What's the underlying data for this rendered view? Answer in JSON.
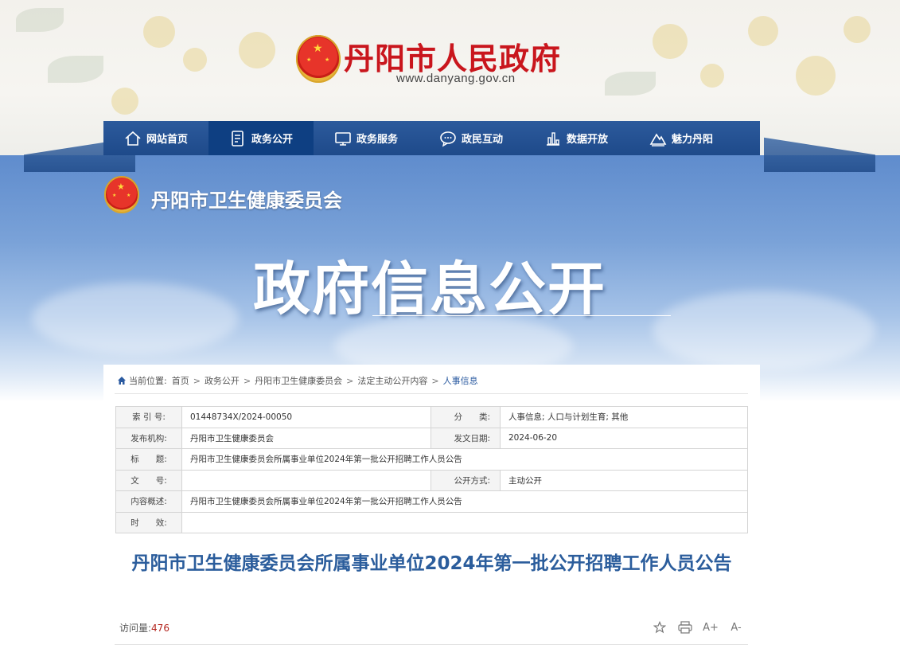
{
  "header": {
    "site_title": "丹阳市人民政府",
    "site_url": "www.danyang.gov.cn"
  },
  "nav": {
    "items": [
      {
        "label": "网站首页",
        "icon": "home-icon"
      },
      {
        "label": "政务公开",
        "icon": "document-icon",
        "active": true
      },
      {
        "label": "政务服务",
        "icon": "monitor-icon"
      },
      {
        "label": "政民互动",
        "icon": "chat-icon"
      },
      {
        "label": "数据开放",
        "icon": "bar-chart-icon"
      },
      {
        "label": "魅力丹阳",
        "icon": "landscape-icon"
      }
    ]
  },
  "hero": {
    "department": "丹阳市卫生健康委员会",
    "title": "政府信息公开"
  },
  "breadcrumb": {
    "label": "当前位置:",
    "items": [
      "首页",
      "政务公开",
      "丹阳市卫生健康委员会",
      "法定主动公开内容",
      "人事信息"
    ]
  },
  "meta": {
    "index_label": "索 引 号:",
    "index_value": "01448734X/2024-00050",
    "category_label": "分　　类:",
    "category_value": "人事信息;  人口与计划生育;  其他",
    "publisher_label": "发布机构:",
    "publisher_value": "丹阳市卫生健康委员会",
    "date_label": "发文日期:",
    "date_value": "2024-06-20",
    "title_label": "标　　题:",
    "title_value": "丹阳市卫生健康委员会所属事业单位2024年第一批公开招聘工作人员公告",
    "docno_label": "文　　号:",
    "docno_value": "",
    "disclosure_label": "公开方式:",
    "disclosure_value": "主动公开",
    "summary_label": "内容概述:",
    "summary_value": "丹阳市卫生健康委员会所属事业单位2024年第一批公开招聘工作人员公告",
    "validity_label": "时　　效:",
    "validity_value": ""
  },
  "article": {
    "title": "丹阳市卫生健康委员会所属事业单位2024年第一批公开招聘工作人员公告",
    "visits_label": "访问量:",
    "visits_value": "476"
  },
  "tools": {
    "font_increase": "A+",
    "font_decrease": "A-"
  },
  "colors": {
    "brand_red": "#c9161d",
    "nav_blue": "#1e4a8a",
    "nav_active": "#0e3f82",
    "title_blue": "#2b5d9c"
  }
}
